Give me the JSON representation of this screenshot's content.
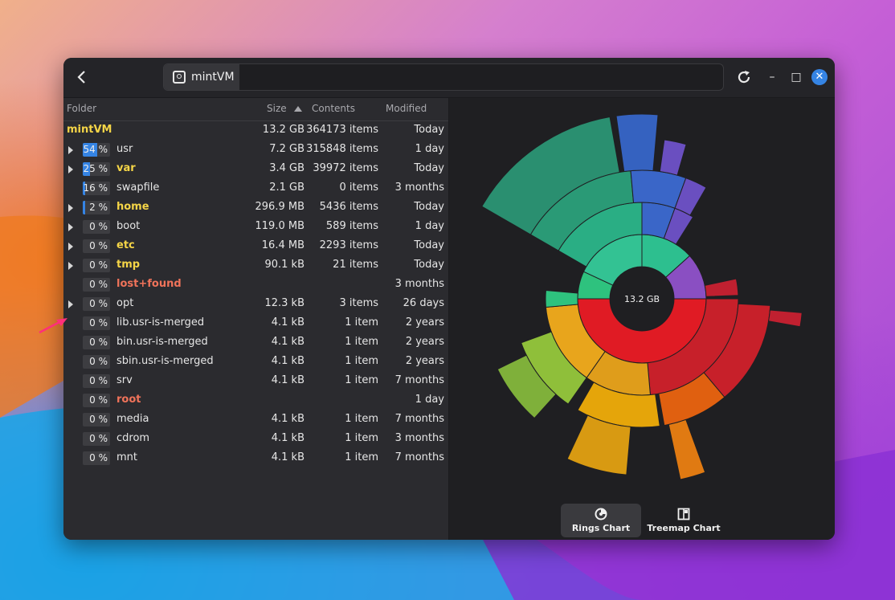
{
  "window": {
    "path_label": "mintVM",
    "back_icon": "back-arrow-icon",
    "reload_icon": "reload-icon",
    "minimize_symbol": "–",
    "maximize_symbol": "□",
    "close_symbol": "✕"
  },
  "columns": {
    "folder": "Folder",
    "size": "Size",
    "contents": "Contents",
    "modified": "Modified"
  },
  "root": {
    "name": "mintVM",
    "size": "13.2 GB",
    "contents": "364173 items",
    "modified": "Today"
  },
  "rows": [
    {
      "name": "usr",
      "pct_label": "54 %",
      "pct": 0.54,
      "size": "7.2 GB",
      "contents": "315848 items",
      "modified": "1 day",
      "expandable": true,
      "style": "normal"
    },
    {
      "name": "var",
      "pct_label": "25 %",
      "pct": 0.25,
      "size": "3.4 GB",
      "contents": "39972 items",
      "modified": "Today",
      "expandable": true,
      "style": "yellow"
    },
    {
      "name": "swapfile",
      "pct_label": "16 %",
      "pct": 0.16,
      "size": "2.1 GB",
      "contents": "0 items",
      "modified": "3 months",
      "expandable": false,
      "style": "normal"
    },
    {
      "name": "home",
      "pct_label": "2 %",
      "pct": 0.02,
      "size": "296.9 MB",
      "contents": "5436 items",
      "modified": "Today",
      "expandable": true,
      "style": "yellow"
    },
    {
      "name": "boot",
      "pct_label": "0 %",
      "pct": 0,
      "size": "119.0 MB",
      "contents": "589 items",
      "modified": "1 day",
      "expandable": true,
      "style": "normal"
    },
    {
      "name": "etc",
      "pct_label": "0 %",
      "pct": 0,
      "size": "16.4 MB",
      "contents": "2293 items",
      "modified": "Today",
      "expandable": true,
      "style": "yellow"
    },
    {
      "name": "tmp",
      "pct_label": "0 %",
      "pct": 0,
      "size": "90.1 kB",
      "contents": "21 items",
      "modified": "Today",
      "expandable": true,
      "style": "yellow"
    },
    {
      "name": "lost+found",
      "pct_label": "0 %",
      "pct": 0,
      "size": "",
      "contents": "",
      "modified": "3 months",
      "expandable": false,
      "style": "red"
    },
    {
      "name": "opt",
      "pct_label": "0 %",
      "pct": 0,
      "size": "12.3 kB",
      "contents": "3 items",
      "modified": "26 days",
      "expandable": true,
      "style": "normal"
    },
    {
      "name": "lib.usr-is-merged",
      "pct_label": "0 %",
      "pct": 0,
      "size": "4.1 kB",
      "contents": "1 item",
      "modified": "2 years",
      "expandable": false,
      "style": "normal"
    },
    {
      "name": "bin.usr-is-merged",
      "pct_label": "0 %",
      "pct": 0,
      "size": "4.1 kB",
      "contents": "1 item",
      "modified": "2 years",
      "expandable": false,
      "style": "normal"
    },
    {
      "name": "sbin.usr-is-merged",
      "pct_label": "0 %",
      "pct": 0,
      "size": "4.1 kB",
      "contents": "1 item",
      "modified": "2 years",
      "expandable": false,
      "style": "normal"
    },
    {
      "name": "srv",
      "pct_label": "0 %",
      "pct": 0,
      "size": "4.1 kB",
      "contents": "1 item",
      "modified": "7 months",
      "expandable": false,
      "style": "normal"
    },
    {
      "name": "root",
      "pct_label": "0 %",
      "pct": 0,
      "size": "",
      "contents": "",
      "modified": "1 day",
      "expandable": false,
      "style": "red"
    },
    {
      "name": "media",
      "pct_label": "0 %",
      "pct": 0,
      "size": "4.1 kB",
      "contents": "1 item",
      "modified": "7 months",
      "expandable": false,
      "style": "normal"
    },
    {
      "name": "cdrom",
      "pct_label": "0 %",
      "pct": 0,
      "size": "4.1 kB",
      "contents": "1 item",
      "modified": "3 months",
      "expandable": false,
      "style": "normal"
    },
    {
      "name": "mnt",
      "pct_label": "0 %",
      "pct": 0,
      "size": "4.1 kB",
      "contents": "1 item",
      "modified": "7 months",
      "expandable": false,
      "style": "normal"
    }
  ],
  "chart": {
    "center_label": "13.2 GB",
    "colors": {
      "red": "#e01b24",
      "orange": "#e5a50a",
      "green": "#2ec27e",
      "blue": "#3584e4",
      "purple": "#9141ac"
    }
  },
  "view_switcher": {
    "rings_label": "Rings Chart",
    "treemap_label": "Treemap Chart",
    "active": "rings"
  }
}
